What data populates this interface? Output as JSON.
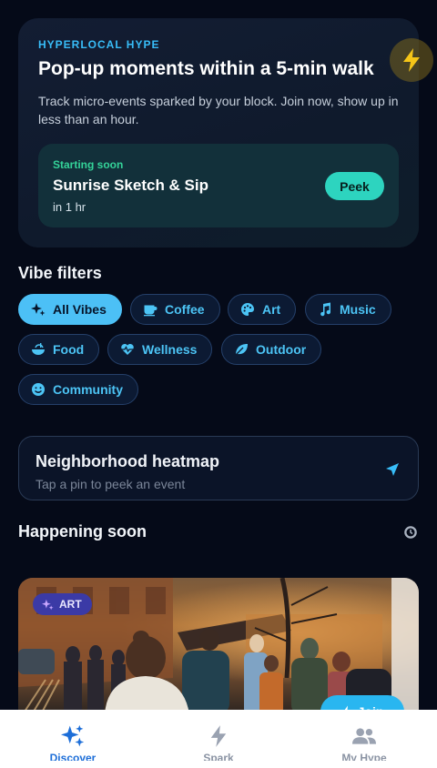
{
  "hero": {
    "eyebrow": "HYPERLOCAL HYPE",
    "title": "Pop-up moments within a 5-min walk",
    "description": "Track micro-events sparked by your block. Join now, show up in less than an hour.",
    "badge_icon": "lightning-bolt-icon",
    "soon_card": {
      "eyebrow": "Starting soon",
      "title": "Sunrise Sketch & Sip",
      "time": "in 1 hr",
      "button": "Peek"
    }
  },
  "filters": {
    "title": "Vibe filters",
    "chips": [
      {
        "label": "All Vibes",
        "icon": "sparkles-icon",
        "active": true
      },
      {
        "label": "Coffee",
        "icon": "coffee-cup-icon"
      },
      {
        "label": "Art",
        "icon": "palette-icon"
      },
      {
        "label": "Music",
        "icon": "music-note-icon"
      },
      {
        "label": "Food",
        "icon": "food-bowl-icon"
      },
      {
        "label": "Wellness",
        "icon": "heart-pulse-icon"
      },
      {
        "label": "Outdoor",
        "icon": "leaf-icon"
      },
      {
        "label": "Community",
        "icon": "smiley-icon"
      }
    ]
  },
  "heatmap": {
    "title": "Neighborhood heatmap",
    "subtitle": "Tap a pin to peek an event",
    "icon": "navigation-arrow-icon"
  },
  "happening": {
    "title": "Happening soon",
    "icon": "history-icon",
    "card": {
      "tag": "ART",
      "join_label": "Join"
    }
  },
  "nav": {
    "items": [
      {
        "label": "Discover",
        "icon": "sparkles-icon",
        "active": true
      },
      {
        "label": "Spark",
        "icon": "lightning-bolt-icon"
      },
      {
        "label": "My Hype",
        "icon": "people-icon"
      }
    ]
  },
  "colors": {
    "background": "#050a18",
    "accent": "#4cc0f6",
    "peek": "#2dd4bf",
    "active_nav": "#1d6ed8"
  }
}
